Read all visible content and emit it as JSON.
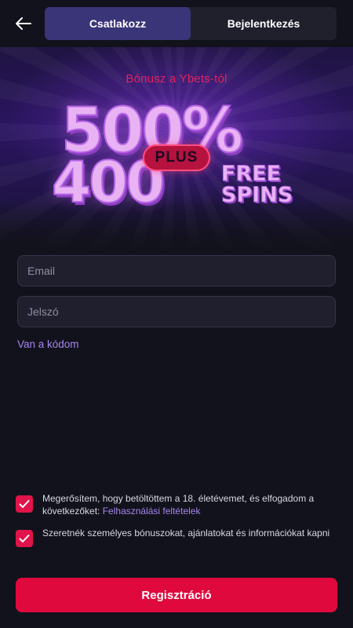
{
  "colors": {
    "background": "#12121c",
    "active_tab": "#3a3478",
    "accent_red": "#e0093e",
    "link_purple": "#a486ee"
  },
  "header": {
    "back_icon": "arrow-left-icon",
    "tabs": [
      {
        "label": "Csatlakozz",
        "active": true
      },
      {
        "label": "Bejelentkezés",
        "active": false
      }
    ]
  },
  "banner": {
    "subtitle": "Bónusz a Ybets-tól",
    "headline_percent": "500%",
    "plus_badge": "PLUS",
    "headline_spins": "400",
    "free_label": "FREE",
    "spins_label": "SPINS"
  },
  "form": {
    "email_placeholder": "Email",
    "password_placeholder": "Jelszó",
    "code_link": "Van a kódom"
  },
  "consents": {
    "age_text": "Megerősítem, hogy betöltöttem a 18. életévemet, és elfogadom a következőket: ",
    "terms_link": "Felhasználási feltételek",
    "age_checked": true,
    "promo_text": "Szeretnék személyes bónuszokat, ajánlatokat és információkat kapni",
    "promo_checked": true,
    "check_icon": "check-icon"
  },
  "register_button": "Regisztráció"
}
